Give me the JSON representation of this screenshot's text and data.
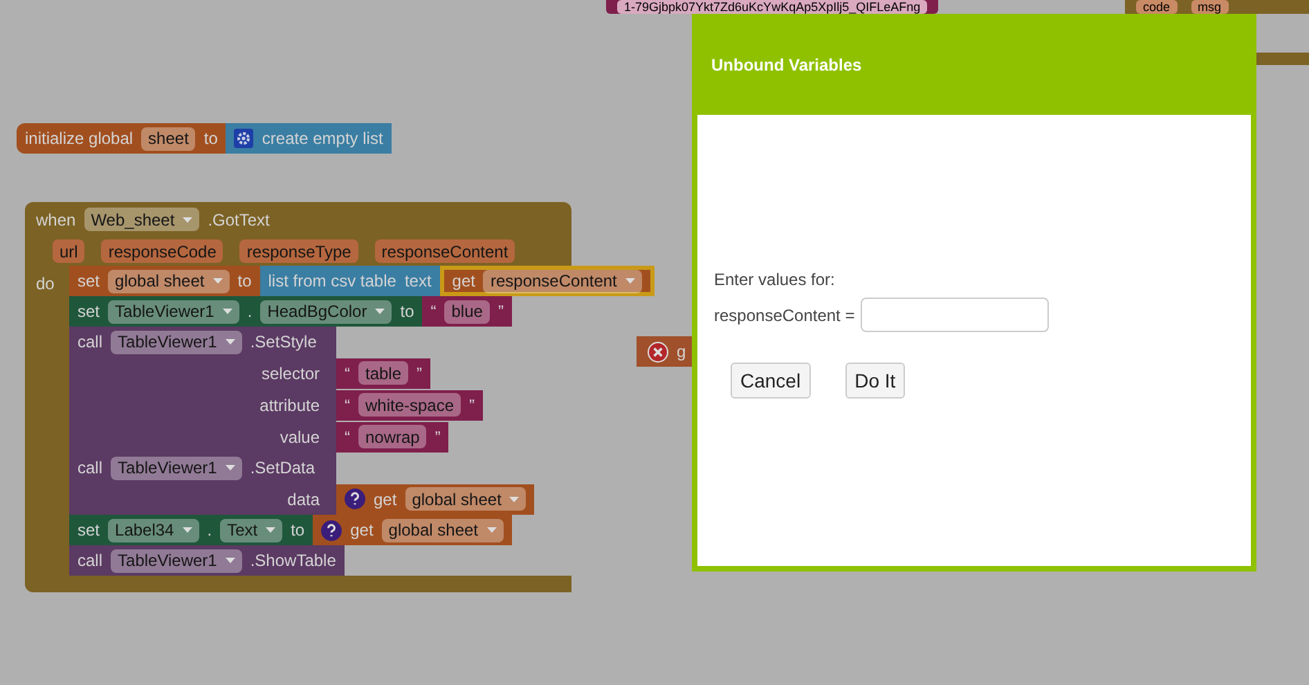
{
  "top_blocks": [
    {
      "kind": "text",
      "text": "1-79Gjbpk07Ykt7Zd6uKcYwKqAp5XpIlj5_QIFLeAFng"
    },
    {
      "kind": "event",
      "params": [
        "code",
        "msg"
      ]
    }
  ],
  "init_block": {
    "label": "initialize global",
    "name": "sheet",
    "to": "to",
    "value": {
      "kind": "list",
      "label": "create empty list"
    }
  },
  "event": {
    "when": "when",
    "component": "Web_sheet",
    "event": ".GotText",
    "params": [
      "url",
      "responseCode",
      "responseType",
      "responseContent"
    ],
    "do": "do",
    "statements": [
      {
        "kind": "set_global",
        "head": [
          {
            "kind": "word",
            "text": "set"
          },
          {
            "kind": "dropdown",
            "text": "global sheet"
          },
          {
            "kind": "word",
            "text": "to"
          }
        ],
        "value": {
          "kind": "csv",
          "label": "list from csv table",
          "socket": "text",
          "value": {
            "kind": "get",
            "label": "get",
            "name": "responseContent",
            "highlighted": true
          }
        }
      },
      {
        "kind": "setter",
        "head": [
          {
            "kind": "word",
            "text": "set"
          },
          {
            "kind": "dropdown",
            "text": "TableViewer1"
          },
          {
            "kind": "word",
            "text": "."
          },
          {
            "kind": "dropdown",
            "text": "HeadBgColor"
          },
          {
            "kind": "word",
            "text": "to"
          }
        ],
        "value": {
          "kind": "string",
          "open": "“",
          "text": "blue",
          "close": "”"
        }
      },
      {
        "kind": "call",
        "head": [
          {
            "kind": "word",
            "text": "call"
          },
          {
            "kind": "dropdown",
            "text": "TableViewer1"
          },
          {
            "kind": "word",
            "text": ".SetStyle"
          }
        ],
        "args": [
          {
            "label": "selector",
            "value": {
              "kind": "string",
              "open": "“",
              "text": "table",
              "close": "”"
            }
          },
          {
            "label": "attribute",
            "value": {
              "kind": "string",
              "open": "“",
              "text": "white-space",
              "close": "”"
            }
          },
          {
            "label": "value",
            "value": {
              "kind": "string",
              "open": "“",
              "text": "nowrap",
              "close": "”"
            }
          }
        ]
      },
      {
        "kind": "call",
        "head": [
          {
            "kind": "word",
            "text": "call"
          },
          {
            "kind": "dropdown",
            "text": "TableViewer1"
          },
          {
            "kind": "word",
            "text": ".SetData"
          }
        ],
        "args": [
          {
            "label": "data",
            "value": {
              "kind": "get_unknown",
              "label": "get",
              "name": "global sheet",
              "highlighted": false
            }
          }
        ]
      },
      {
        "kind": "setter",
        "head": [
          {
            "kind": "word",
            "text": "set"
          },
          {
            "kind": "dropdown",
            "text": "Label34"
          },
          {
            "kind": "word",
            "text": "."
          },
          {
            "kind": "dropdown",
            "text": "Text"
          },
          {
            "kind": "word",
            "text": "to"
          }
        ],
        "value": {
          "kind": "get_unknown",
          "label": "get",
          "name": "global sheet",
          "highlighted": false
        }
      },
      {
        "kind": "call",
        "head": [
          {
            "kind": "word",
            "text": "call"
          },
          {
            "kind": "dropdown",
            "text": "TableViewer1"
          },
          {
            "kind": "word",
            "text": ".ShowTable"
          }
        ]
      }
    ]
  },
  "orphan_block": {
    "kind": "error",
    "text": "g"
  },
  "dialog": {
    "title": "Unbound Variables",
    "prompt": "Enter values for:",
    "fields": [
      {
        "label": "responseContent ="
      }
    ],
    "buttons": [
      "Cancel",
      "Do It"
    ]
  }
}
